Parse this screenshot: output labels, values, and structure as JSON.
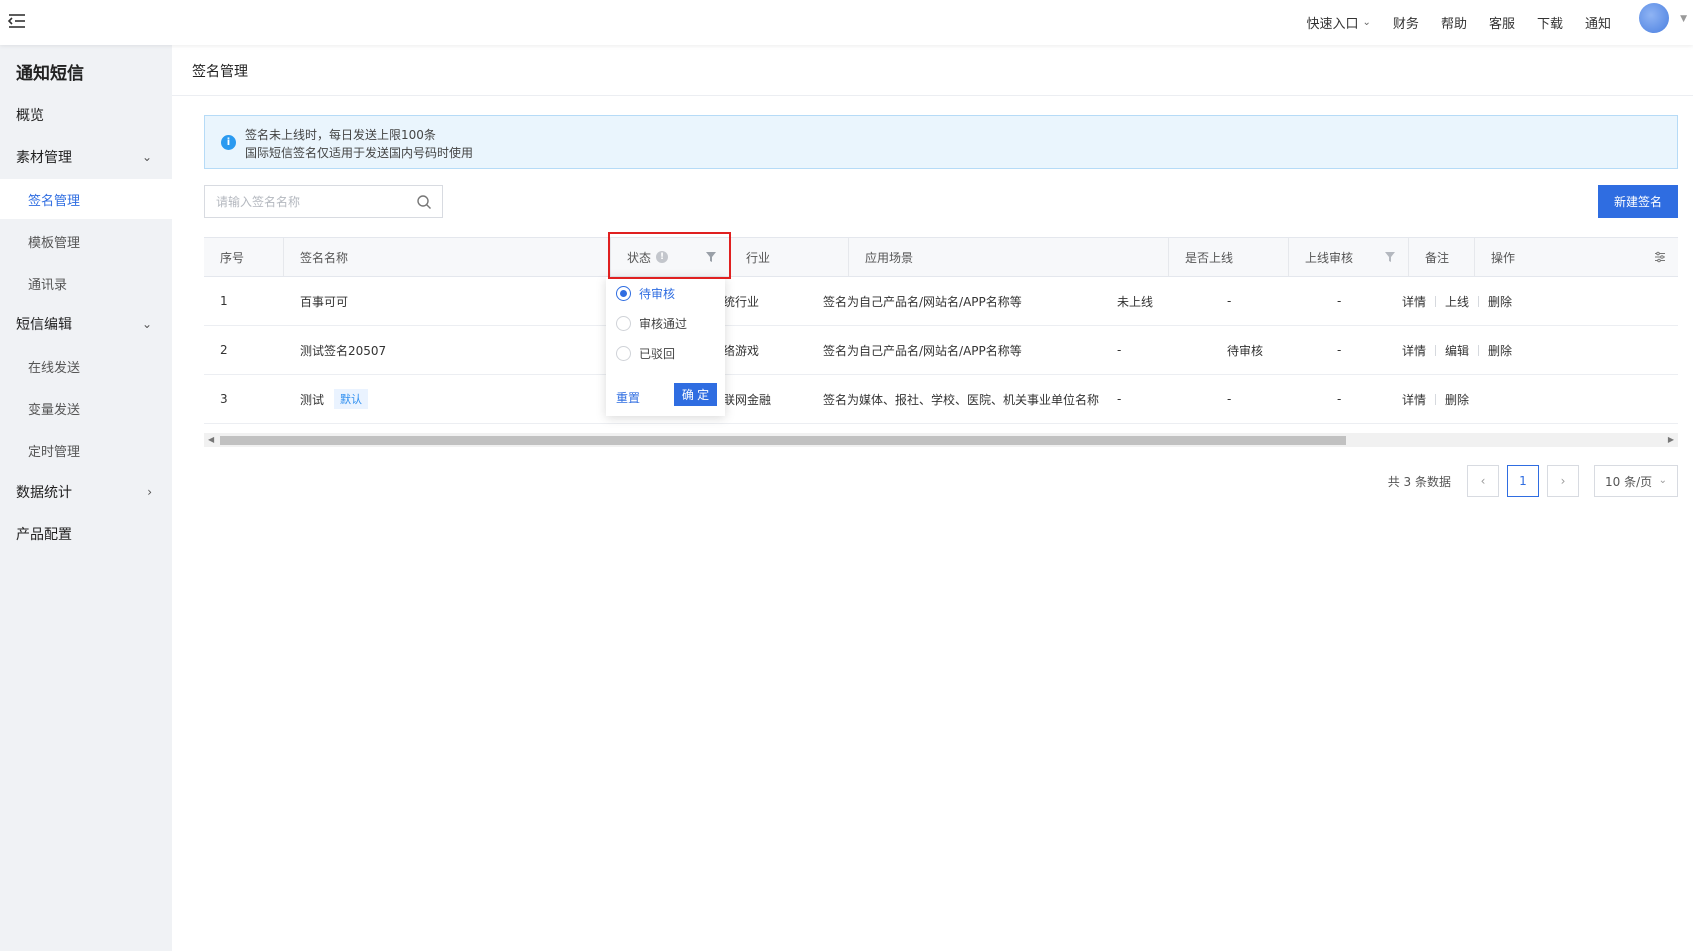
{
  "topbar": {
    "links": [
      "快速入口",
      "财务",
      "帮助",
      "客服",
      "下载",
      "通知"
    ]
  },
  "sidebar": {
    "title": "通知短信",
    "items": [
      {
        "label": "概览"
      },
      {
        "label": "素材管理"
      },
      {
        "label": "签名管理"
      },
      {
        "label": "模板管理"
      },
      {
        "label": "通讯录"
      },
      {
        "label": "短信编辑"
      },
      {
        "label": "在线发送"
      },
      {
        "label": "变量发送"
      },
      {
        "label": "定时管理"
      },
      {
        "label": "数据统计"
      },
      {
        "label": "产品配置"
      }
    ]
  },
  "page": {
    "title": "签名管理",
    "alert": {
      "line1": "签名未上线时，每日发送上限100条",
      "line2": "国际短信签名仅适用于发送国内号码时使用"
    },
    "search": {
      "placeholder": "请输入签名名称",
      "value": ""
    },
    "new_button": "新建签名"
  },
  "table": {
    "columns": [
      "序号",
      "签名名称",
      "状态",
      "行业",
      "应用场景",
      "是否上线",
      "上线审核",
      "备注",
      "操作"
    ],
    "rows": [
      {
        "index": "1",
        "name": "百事可可",
        "tag": "",
        "industry": "传统行业",
        "scene": "签名为自己产品名/网站名/APP名称等",
        "online": "未上线",
        "review": "-",
        "note": "-",
        "ops": [
          "详情",
          "上线",
          "删除"
        ]
      },
      {
        "index": "2",
        "name": "测试签名20507",
        "tag": "",
        "industry": "网络游戏",
        "scene": "签名为自己产品名/网站名/APP名称等",
        "online": "-",
        "review": "待审核",
        "note": "-",
        "ops": [
          "详情",
          "编辑",
          "删除"
        ]
      },
      {
        "index": "3",
        "name": "测试",
        "tag": "默认",
        "industry": "互联网金融",
        "scene": "签名为媒体、报社、学校、医院、机关事业单位名称",
        "online": "-",
        "review": "-",
        "note": "-",
        "ops": [
          "详情",
          "删除"
        ]
      }
    ]
  },
  "status_filter": {
    "options": [
      "待审核",
      "审核通过",
      "已驳回"
    ],
    "selected": "待审核",
    "reset_label": "重置",
    "confirm_label": "确 定"
  },
  "pagination": {
    "total_text": "共 3 条数据",
    "current_page": "1",
    "page_size": "10 条/页"
  },
  "colors": {
    "accent": "#2f6de1",
    "highlight": "#e02020",
    "sidebar_bg": "#f0f2f5"
  }
}
